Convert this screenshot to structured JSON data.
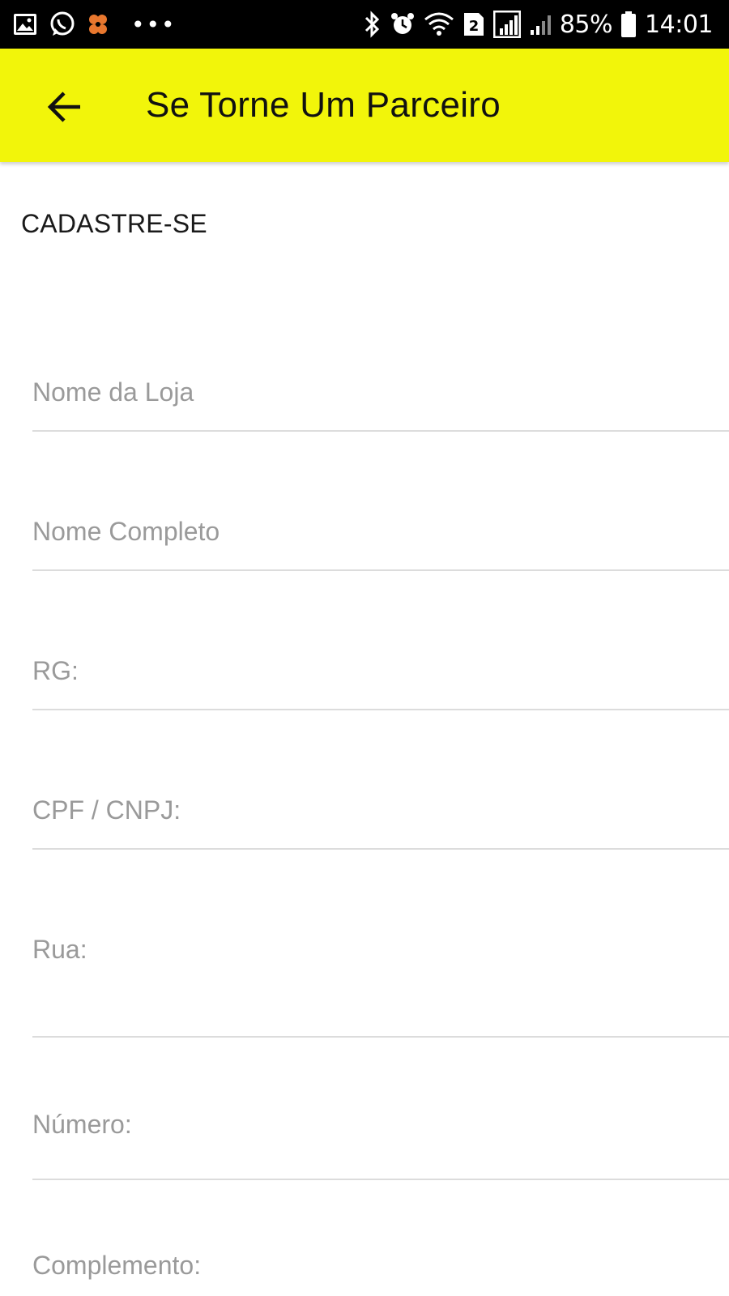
{
  "status_bar": {
    "icons_left": [
      "gallery-icon",
      "whatsapp-icon",
      "app-notification-icon",
      "more-dots-icon"
    ],
    "dots": "•••",
    "icons_right": [
      "bluetooth-icon",
      "alarm-icon",
      "wifi-icon",
      "sim2-icon",
      "signal-icon",
      "signal-icon-2",
      "battery-icon"
    ],
    "sim_label": "2",
    "battery": "85%",
    "time": "14:01"
  },
  "app_bar": {
    "title": "Se Torne Um Parceiro",
    "color": "#f2f50a"
  },
  "form": {
    "section_title": "CADASTRE-SE",
    "fields": [
      {
        "placeholder": "Nome da Loja",
        "value": ""
      },
      {
        "placeholder": "Nome Completo",
        "value": ""
      },
      {
        "placeholder": "RG:",
        "value": ""
      },
      {
        "placeholder": "CPF / CNPJ:",
        "value": ""
      },
      {
        "placeholder": "Rua:",
        "value": ""
      },
      {
        "placeholder": "Número:",
        "value": ""
      },
      {
        "placeholder": "Complemento:",
        "value": ""
      }
    ]
  }
}
